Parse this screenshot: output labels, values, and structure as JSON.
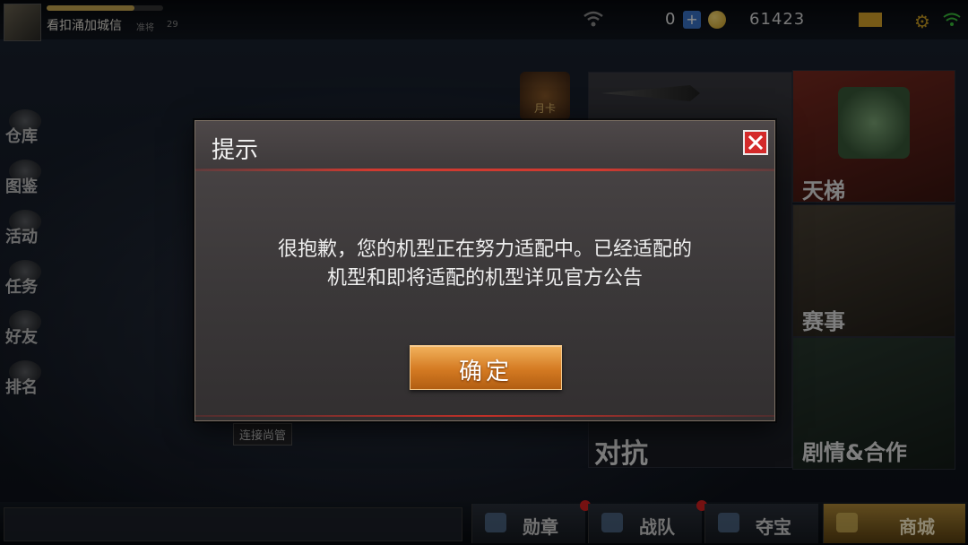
{
  "topbar": {
    "player_name": "看扣涌加城信",
    "rank_label": "准将",
    "rank_value": "29",
    "xp_progress": 0.75,
    "diamonds": "0",
    "plus": "+",
    "coins": "61423",
    "settings_icon": "gear-icon"
  },
  "left_menu": [
    {
      "label": "仓库",
      "icon": "warehouse-icon"
    },
    {
      "label": "图鉴",
      "icon": "catalog-icon"
    },
    {
      "label": "活动",
      "icon": "event-icon"
    },
    {
      "label": "任务",
      "icon": "mission-icon"
    },
    {
      "label": "好友",
      "icon": "friends-icon"
    },
    {
      "label": "排名",
      "icon": "ranking-icon"
    }
  ],
  "tiles": {
    "badge": "月卡",
    "ladder": "天梯",
    "match": "赛事",
    "versus": "对抗",
    "story": "剧情&合作",
    "tag": "连接尚管"
  },
  "bottom_bar": {
    "items": [
      {
        "label": "勋章",
        "icon": "medal-icon",
        "has_dot": true
      },
      {
        "label": "战队",
        "icon": "team-icon",
        "has_dot": true
      },
      {
        "label": "夺宝",
        "icon": "treasure-icon",
        "has_dot": false
      },
      {
        "label": "商城",
        "icon": "shop-icon",
        "has_dot": false
      }
    ]
  },
  "dialog": {
    "title": "提示",
    "message_line1": "很抱歉，您的机型正在努力适配中。已经适配的",
    "message_line2": "机型和即将适配的机型详见官方公告",
    "ok_label": "确定",
    "close_icon": "close-icon",
    "accent_color": "#d42a2a",
    "button_color": "#d47a22"
  }
}
